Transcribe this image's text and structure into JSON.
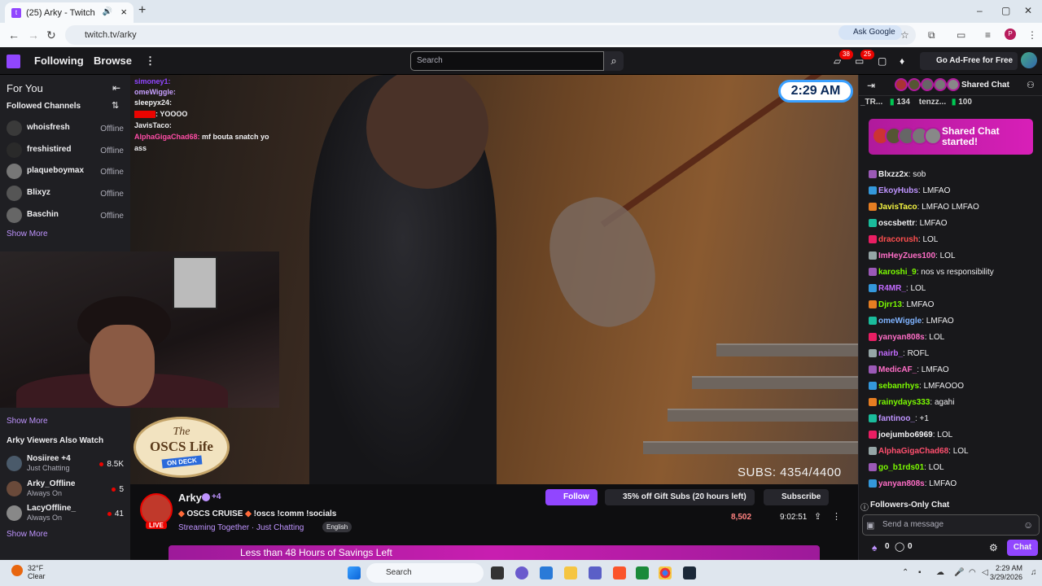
{
  "browser": {
    "tab_title": "(25) Arky - Twitch",
    "url": "twitch.tv/arky",
    "ask_google": "Ask Google",
    "profile_initial": "P"
  },
  "twitch": {
    "nav_following": "Following",
    "nav_browse": "Browse",
    "search_placeholder": "Search",
    "badge1": "38",
    "badge2": "25",
    "ad_free": "Go Ad-Free for Free"
  },
  "sidebar": {
    "for_you": "For You",
    "followed_channels": "Followed Channels",
    "followed": [
      {
        "name": "whoisfresh",
        "status": "Offline"
      },
      {
        "name": "freshistired",
        "status": "Offline"
      },
      {
        "name": "plaqueboymax",
        "status": "Offline"
      },
      {
        "name": "Blixyz",
        "status": "Offline"
      },
      {
        "name": "Baschin",
        "status": "Offline"
      }
    ],
    "show_more": "Show More",
    "show_more2": "Show More",
    "also_watch": "Arky Viewers Also Watch",
    "recs": [
      {
        "name": "Nosiiree +4",
        "cat": "Just Chatting",
        "viewers": "8.5K"
      },
      {
        "name": "Arky_Offline",
        "cat": "Always On",
        "viewers": "5"
      },
      {
        "name": "LacyOffline_",
        "cat": "Always On",
        "viewers": "41"
      }
    ],
    "show_more3": "Show More"
  },
  "video": {
    "clock": "2:29 AM",
    "subs": "SUBS: 4354/4400",
    "oscs_top": "The",
    "oscs_main": "OSCS Life",
    "oscs_tag": "ON DECK",
    "overlay_chat": [
      {
        "u": "simoney1:",
        "t": "",
        "c": "#9146ff"
      },
      {
        "u": "omeWiggle:",
        "t": "",
        "c": "#c8a0ff"
      },
      {
        "u": "sleepyx24:",
        "t": "",
        "c": "#efeff1"
      },
      {
        "u": "",
        "t": ": YOOOO",
        "c": "#eb0400"
      },
      {
        "u": "JavisTaco:",
        "t": "",
        "c": "#efeff1"
      },
      {
        "u": "AlphaGigaChad68:",
        "t": "mf bouta snatch yo",
        "c": "#ff4da6"
      },
      {
        "u": "",
        "t": "ass",
        "c": "#efeff1"
      }
    ]
  },
  "stream": {
    "channel": "Arky",
    "plus": "+4",
    "title": "OSCS CRUISE",
    "commands": "!oscs !comm !socials",
    "team": "Streaming Together · Just Chatting",
    "lang": "English",
    "follow": "Follow",
    "gift_subs": "35% off Gift Subs (20 hours left)",
    "subscribe": "Subscribe",
    "viewers": "8,502",
    "uptime": "9:02:51",
    "banner": "Less than 48 Hours of Savings Left",
    "live": "LIVE"
  },
  "chat": {
    "shared_chat": "Shared Chat",
    "top_left": "_TR...",
    "count1": "134",
    "top_mid": "tenzz...",
    "count2": "100",
    "banner": "Shared Chat started!",
    "messages": [
      {
        "u": "Blxzz2x",
        "t": ": sob",
        "c": "#efeff1"
      },
      {
        "u": "EkoyHubs",
        "t": ": LMFAO",
        "c": "#bf94ff"
      },
      {
        "u": "JavisTaco",
        "t": ": LMFAO LMFAO",
        "c": "#f5f542"
      },
      {
        "u": "oscsbettr",
        "t": ": LMFAO",
        "c": "#efeff1"
      },
      {
        "u": "dracorush",
        "t": ": LOL",
        "c": "#ff4f4f"
      },
      {
        "u": "ImHeyZues100",
        "t": ": LOL",
        "c": "#ff6ec7"
      },
      {
        "u": "karoshi_9",
        "t": ": nos vs responsibility",
        "c": "#7cfc00"
      },
      {
        "u": "R4MR_",
        "t": ": LOL",
        "c": "#c36bff"
      },
      {
        "u": "Djrr13",
        "t": ": LMFAO",
        "c": "#7cfc00"
      },
      {
        "u": "omeWiggle",
        "t": ": LMFAO",
        "c": "#7fb3ff"
      },
      {
        "u": "yanyan808s",
        "t": ": LOL",
        "c": "#ff6ec7"
      },
      {
        "u": "nairb_",
        "t": ": ROFL",
        "c": "#c36bff"
      },
      {
        "u": "MedicAF_",
        "t": ": LMFAO",
        "c": "#ff6ec7"
      },
      {
        "u": "sebanrhys",
        "t": ": LMFAOOO",
        "c": "#7cfc00"
      },
      {
        "u": "rainydays333",
        "t": ": agahi",
        "c": "#7cfc00"
      },
      {
        "u": "fantinoo_",
        "t": ": +1",
        "c": "#bf94ff"
      },
      {
        "u": "joejumbo6969",
        "t": ": LOL",
        "c": "#efeff1"
      },
      {
        "u": "AlphaGigaChad68",
        "t": ": LOL",
        "c": "#ff4f6e"
      },
      {
        "u": "go_b1rds01",
        "t": ": LOL",
        "c": "#7cfc00"
      },
      {
        "u": "yanyan808s",
        "t": ": LMFAO",
        "c": "#ff6ec7"
      }
    ],
    "followers_only": "Followers-Only Chat",
    "send_placeholder": "Send a message",
    "points": "0",
    "points2": "0",
    "chat_button": "Chat"
  },
  "taskbar": {
    "temp": "32°F",
    "cond": "Clear",
    "search": "Search",
    "time": "2:29 AM",
    "date": "3/29/2026"
  }
}
